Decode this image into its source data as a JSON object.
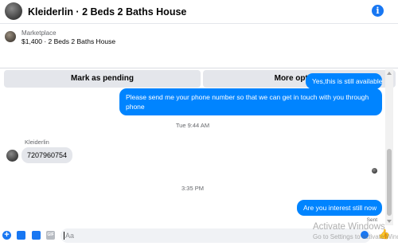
{
  "header": {
    "title": "Kleiderlin · 2 Beds 2 Baths House",
    "info_icon": "info-icon"
  },
  "listing": {
    "category": "Marketplace",
    "description": "$1,400 · 2 Beds 2 Baths House",
    "buttons": {
      "pending": "Mark as pending",
      "options": "More options"
    }
  },
  "thread": {
    "messages": [
      {
        "direction": "out",
        "text": "Yes,this is still available"
      },
      {
        "direction": "out",
        "text": "Please send me your phone  number so that we can get in touch with you through phone"
      },
      {
        "direction": "timestamp",
        "text": "Tue 9:44 AM"
      },
      {
        "direction": "in",
        "sender": "Kleiderlin",
        "text": "7207960754"
      },
      {
        "direction": "timestamp",
        "text": "3:35 PM"
      },
      {
        "direction": "out",
        "text": "Are you interest still now"
      }
    ],
    "status": "Sent"
  },
  "composer": {
    "placeholder": "Aa"
  },
  "watermark": {
    "line1": "Activate Windows",
    "line2": "Go to Settings to activate Windows."
  },
  "colors": {
    "accent": "#0084ff",
    "incoming": "#e4e6eb"
  }
}
